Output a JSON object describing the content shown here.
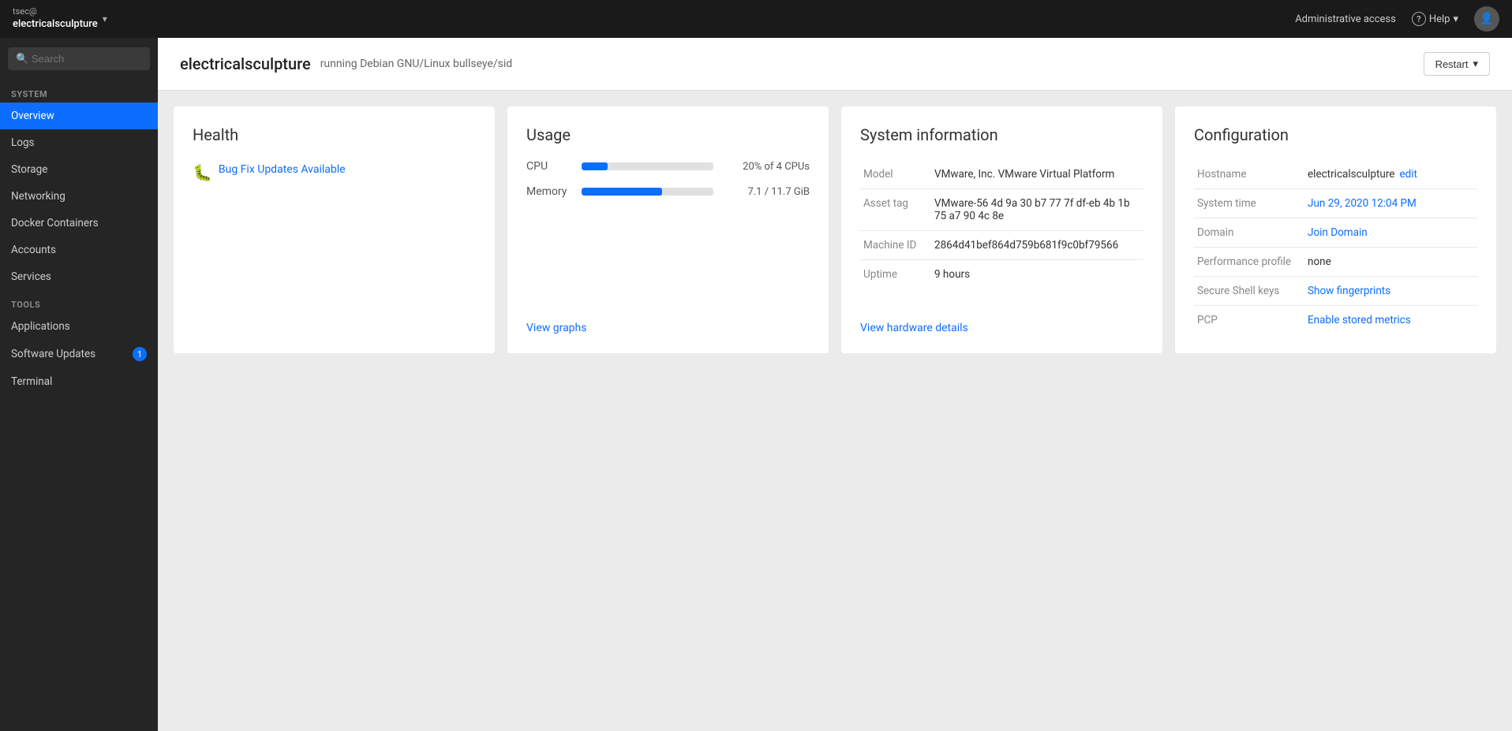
{
  "topbar": {
    "user_line1": "tsec@",
    "user_line2": "electricalsculpture",
    "admin_label": "Administrative access",
    "help_label": "Help",
    "chevron": "▾"
  },
  "sidebar": {
    "search_placeholder": "Search",
    "sections": [
      {
        "label": "System",
        "items": [
          {
            "id": "overview",
            "label": "Overview",
            "active": true
          },
          {
            "id": "logs",
            "label": "Logs",
            "active": false
          },
          {
            "id": "storage",
            "label": "Storage",
            "active": false
          },
          {
            "id": "networking",
            "label": "Networking",
            "active": false
          },
          {
            "id": "docker-containers",
            "label": "Docker Containers",
            "active": false
          },
          {
            "id": "accounts",
            "label": "Accounts",
            "active": false
          },
          {
            "id": "services",
            "label": "Services",
            "active": false
          }
        ]
      },
      {
        "label": "Tools",
        "items": [
          {
            "id": "applications",
            "label": "Applications",
            "active": false,
            "badge": null
          },
          {
            "id": "software-updates",
            "label": "Software Updates",
            "active": false,
            "badge": "1"
          },
          {
            "id": "terminal",
            "label": "Terminal",
            "active": false,
            "badge": null
          }
        ]
      }
    ]
  },
  "main": {
    "hostname": "electricalsculpture",
    "subtitle": "running Debian GNU/Linux bullseye/sid",
    "restart_label": "Restart",
    "cards": {
      "health": {
        "title": "Health",
        "bug_fix_label": "Bug Fix Updates Available"
      },
      "usage": {
        "title": "Usage",
        "cpu_label": "CPU",
        "cpu_percent": 20,
        "cpu_value": "20% of 4 CPUs",
        "memory_label": "Memory",
        "memory_percent": 61,
        "memory_value": "7.1 / 11.7 GiB",
        "footer_link": "View graphs"
      },
      "sysinfo": {
        "title": "System information",
        "rows": [
          {
            "label": "Model",
            "value": "VMware, Inc. VMware Virtual Platform"
          },
          {
            "label": "Asset tag",
            "value": "VMware-56 4d 9a 30 b7 77 7f df-eb 4b 1b 75 a7 90 4c 8e"
          },
          {
            "label": "Machine ID",
            "value": "2864d41bef864d759b681f9c0bf79566"
          },
          {
            "label": "Uptime",
            "value": "9 hours"
          }
        ],
        "footer_link": "View hardware details"
      },
      "config": {
        "title": "Configuration",
        "rows": [
          {
            "label": "Hostname",
            "value": "electricalsculpture",
            "link": null,
            "edit_link": "edit"
          },
          {
            "label": "System time",
            "value": "Jun 29, 2020 12:04 PM",
            "link": true
          },
          {
            "label": "Domain",
            "value": "Join Domain",
            "link": true
          },
          {
            "label": "Performance profile",
            "value": "none",
            "link": false
          },
          {
            "label": "Secure Shell keys",
            "value": "Show fingerprints",
            "link": true
          },
          {
            "label": "PCP",
            "value": "Enable stored metrics",
            "link": true
          }
        ]
      }
    }
  }
}
